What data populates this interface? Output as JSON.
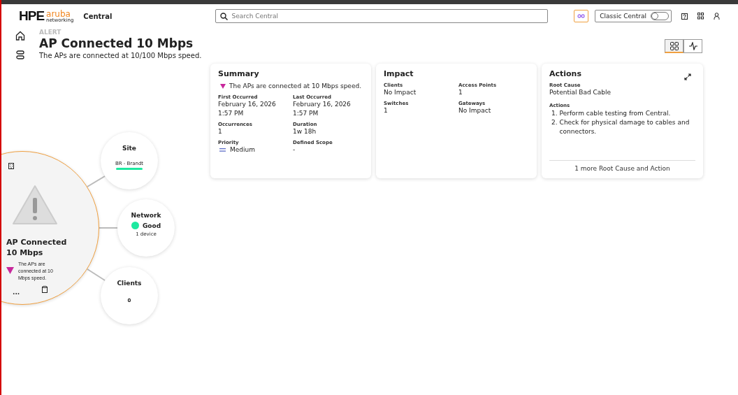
{
  "header": {
    "logo": {
      "brand": "HPE",
      "product": "aruba",
      "sub": "networking"
    },
    "app_name": "Central",
    "search": {
      "placeholder": "Search Central"
    },
    "classic_toggle": {
      "label": "Classic Central",
      "on": false
    }
  },
  "view_switch": [
    {
      "kind": "grid",
      "selected": true
    },
    {
      "kind": "pulse",
      "selected": false
    }
  ],
  "alert": {
    "eyebrow": "ALERT",
    "title": "AP Connected 10 Mbps",
    "description": "The APs are connected at 10/100 Mbps speed."
  },
  "summary": {
    "title": "Summary",
    "severity_text": "The APs are connected at 10 Mbps speed.",
    "fields": [
      {
        "label": "First Occurred",
        "value": "February 16, 2026 1:57 PM"
      },
      {
        "label": "Last Occurred",
        "value": "February 16, 2026 1:57 PM"
      },
      {
        "label": "Occurrences",
        "value": "1"
      },
      {
        "label": "Duration",
        "value": "1w 18h"
      },
      {
        "label": "Priority",
        "value": "Medium",
        "kind": "priority"
      },
      {
        "label": "Defined Scope",
        "value": "-"
      }
    ]
  },
  "impact": {
    "title": "Impact",
    "fields": [
      {
        "label": "Clients",
        "value": "No Impact"
      },
      {
        "label": "Access Points",
        "value": "1"
      },
      {
        "label": "Switches",
        "value": "1"
      },
      {
        "label": "Gateways",
        "value": "No Impact"
      }
    ]
  },
  "actions": {
    "title": "Actions",
    "root_cause_label": "Root Cause",
    "root_cause": "Potential Bad Cable",
    "actions_label": "Actions",
    "steps": [
      {
        "marker": "1.",
        "text": "Perform cable testing from Central."
      },
      {
        "marker": "2.",
        "text": "Check for physical damage to cables and connectors."
      }
    ],
    "more_link": "1 more Root Cause and Action"
  },
  "diagram": {
    "center": {
      "title": "AP Connected 10 Mbps",
      "description": "The APs are connected at 10 Mbps speed.",
      "more": "..."
    },
    "nodes": [
      {
        "kind": "site",
        "title": "Site",
        "value": "BR - Brandt"
      },
      {
        "kind": "network",
        "title": "Network",
        "status": "Good",
        "color": "#1de9a0",
        "detail": "1 device"
      },
      {
        "kind": "clients",
        "title": "Clients",
        "value": "0"
      }
    ]
  }
}
